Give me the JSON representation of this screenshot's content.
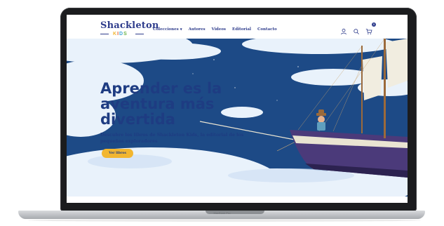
{
  "header": {
    "logo_text": "Shackleton",
    "logo_sub_letters": [
      "K",
      "I",
      "D",
      "S"
    ],
    "nav": [
      {
        "label": "Colecciones",
        "has_dropdown": true
      },
      {
        "label": "Autores"
      },
      {
        "label": "Videos"
      },
      {
        "label": "Editorial"
      },
      {
        "label": "Contacto"
      }
    ],
    "icons": [
      "user-icon",
      "search-icon",
      "cart-icon"
    ],
    "cart_count": "0"
  },
  "hero": {
    "title": "Aprender es la aventura más divertida",
    "description": "Descubre los libros de Shackleton Kids, la editorial de los pequeños exploradores",
    "cta_label": "Ver libros"
  },
  "device": {
    "label": "MacBook Pro"
  },
  "colors": {
    "brand_navy": "#2e3c8c",
    "accent_yellow": "#f2b630",
    "sky_blue": "#1d4a86",
    "cloud_white": "#e9f2fb"
  }
}
